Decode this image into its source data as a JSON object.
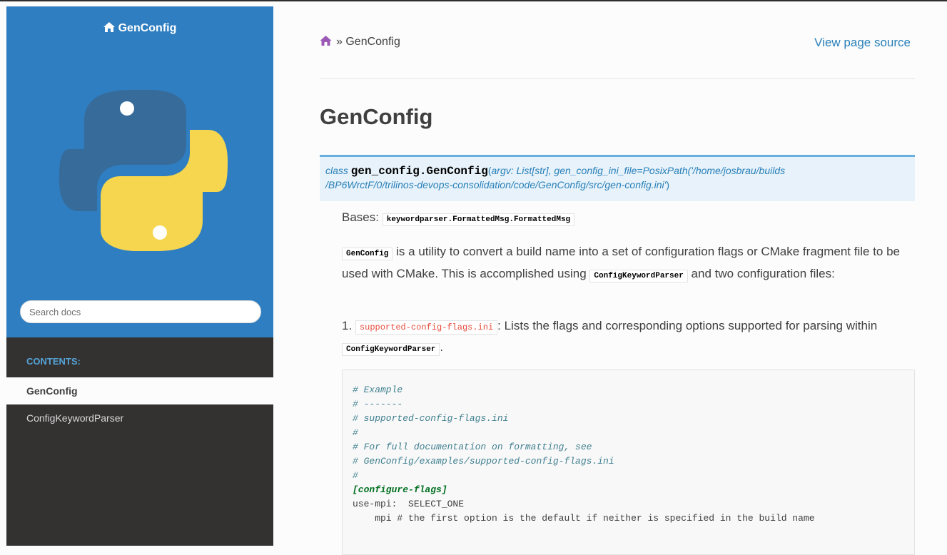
{
  "sidebar": {
    "brand": "GenConfig",
    "search_placeholder": "Search docs",
    "caption": "CONTENTS:",
    "items": [
      {
        "label": "GenConfig",
        "current": true
      },
      {
        "label": "ConfigKeywordParser",
        "current": false
      }
    ]
  },
  "header": {
    "breadcrumb_sep": "»",
    "breadcrumb_current": "GenConfig",
    "view_source": "View page source"
  },
  "main": {
    "title": "GenConfig",
    "signature": {
      "prefix": "class",
      "name": "gen_config.GenConfig",
      "open": "(",
      "params_line1": "argv: List[str], gen_config_ini_file=PosixPath('/home/josbrau/builds",
      "params_line2": "/BP6WrctF/0/trilinos-devops-consolidation/code/GenConfig/src/gen-config.ini'",
      "close": ")"
    },
    "bases_label": "Bases:",
    "bases_value": "keywordparser.FormattedMsg.FormattedMsg",
    "para1": {
      "code1": "GenConfig",
      "text1": " is a utility to convert a build name into a set of configuration flags or CMake fragment file to be used with CMake. This is accomplished using ",
      "code2": "ConfigKeywordParser",
      "text2": " and two configuration files:"
    },
    "item1": {
      "num": "1.",
      "code1": "supported-config-flags.ini",
      "text1": ": Lists the flags and corresponding options supported for parsing within ",
      "code2": "ConfigKeywordParser",
      "text2": "."
    },
    "code_lines": [
      {
        "cls": "c",
        "text": "# Example"
      },
      {
        "cls": "c",
        "text": "# -------"
      },
      {
        "cls": "c",
        "text": "# supported-config-flags.ini"
      },
      {
        "cls": "c",
        "text": "#"
      },
      {
        "cls": "c",
        "text": "# For full documentation on formatting, see"
      },
      {
        "cls": "c",
        "text": "# GenConfig/examples/supported-config-flags.ini"
      },
      {
        "cls": "c",
        "text": "#"
      },
      {
        "cls": "t",
        "text": ""
      },
      {
        "cls": "k",
        "text": "[configure-flags]"
      },
      {
        "cls": "t",
        "text": "use-mpi:  SELECT_ONE"
      },
      {
        "cls": "t",
        "text": "    mpi # the first option is the default if neither is specified in the build name"
      }
    ]
  },
  "colors": {
    "sidebar_top": "#2f7ec1",
    "sidebar_bg": "#343131",
    "link": "#2980b9",
    "sig_bg": "#e7f2fa",
    "breadcrumb_home": "#9b59b6"
  }
}
